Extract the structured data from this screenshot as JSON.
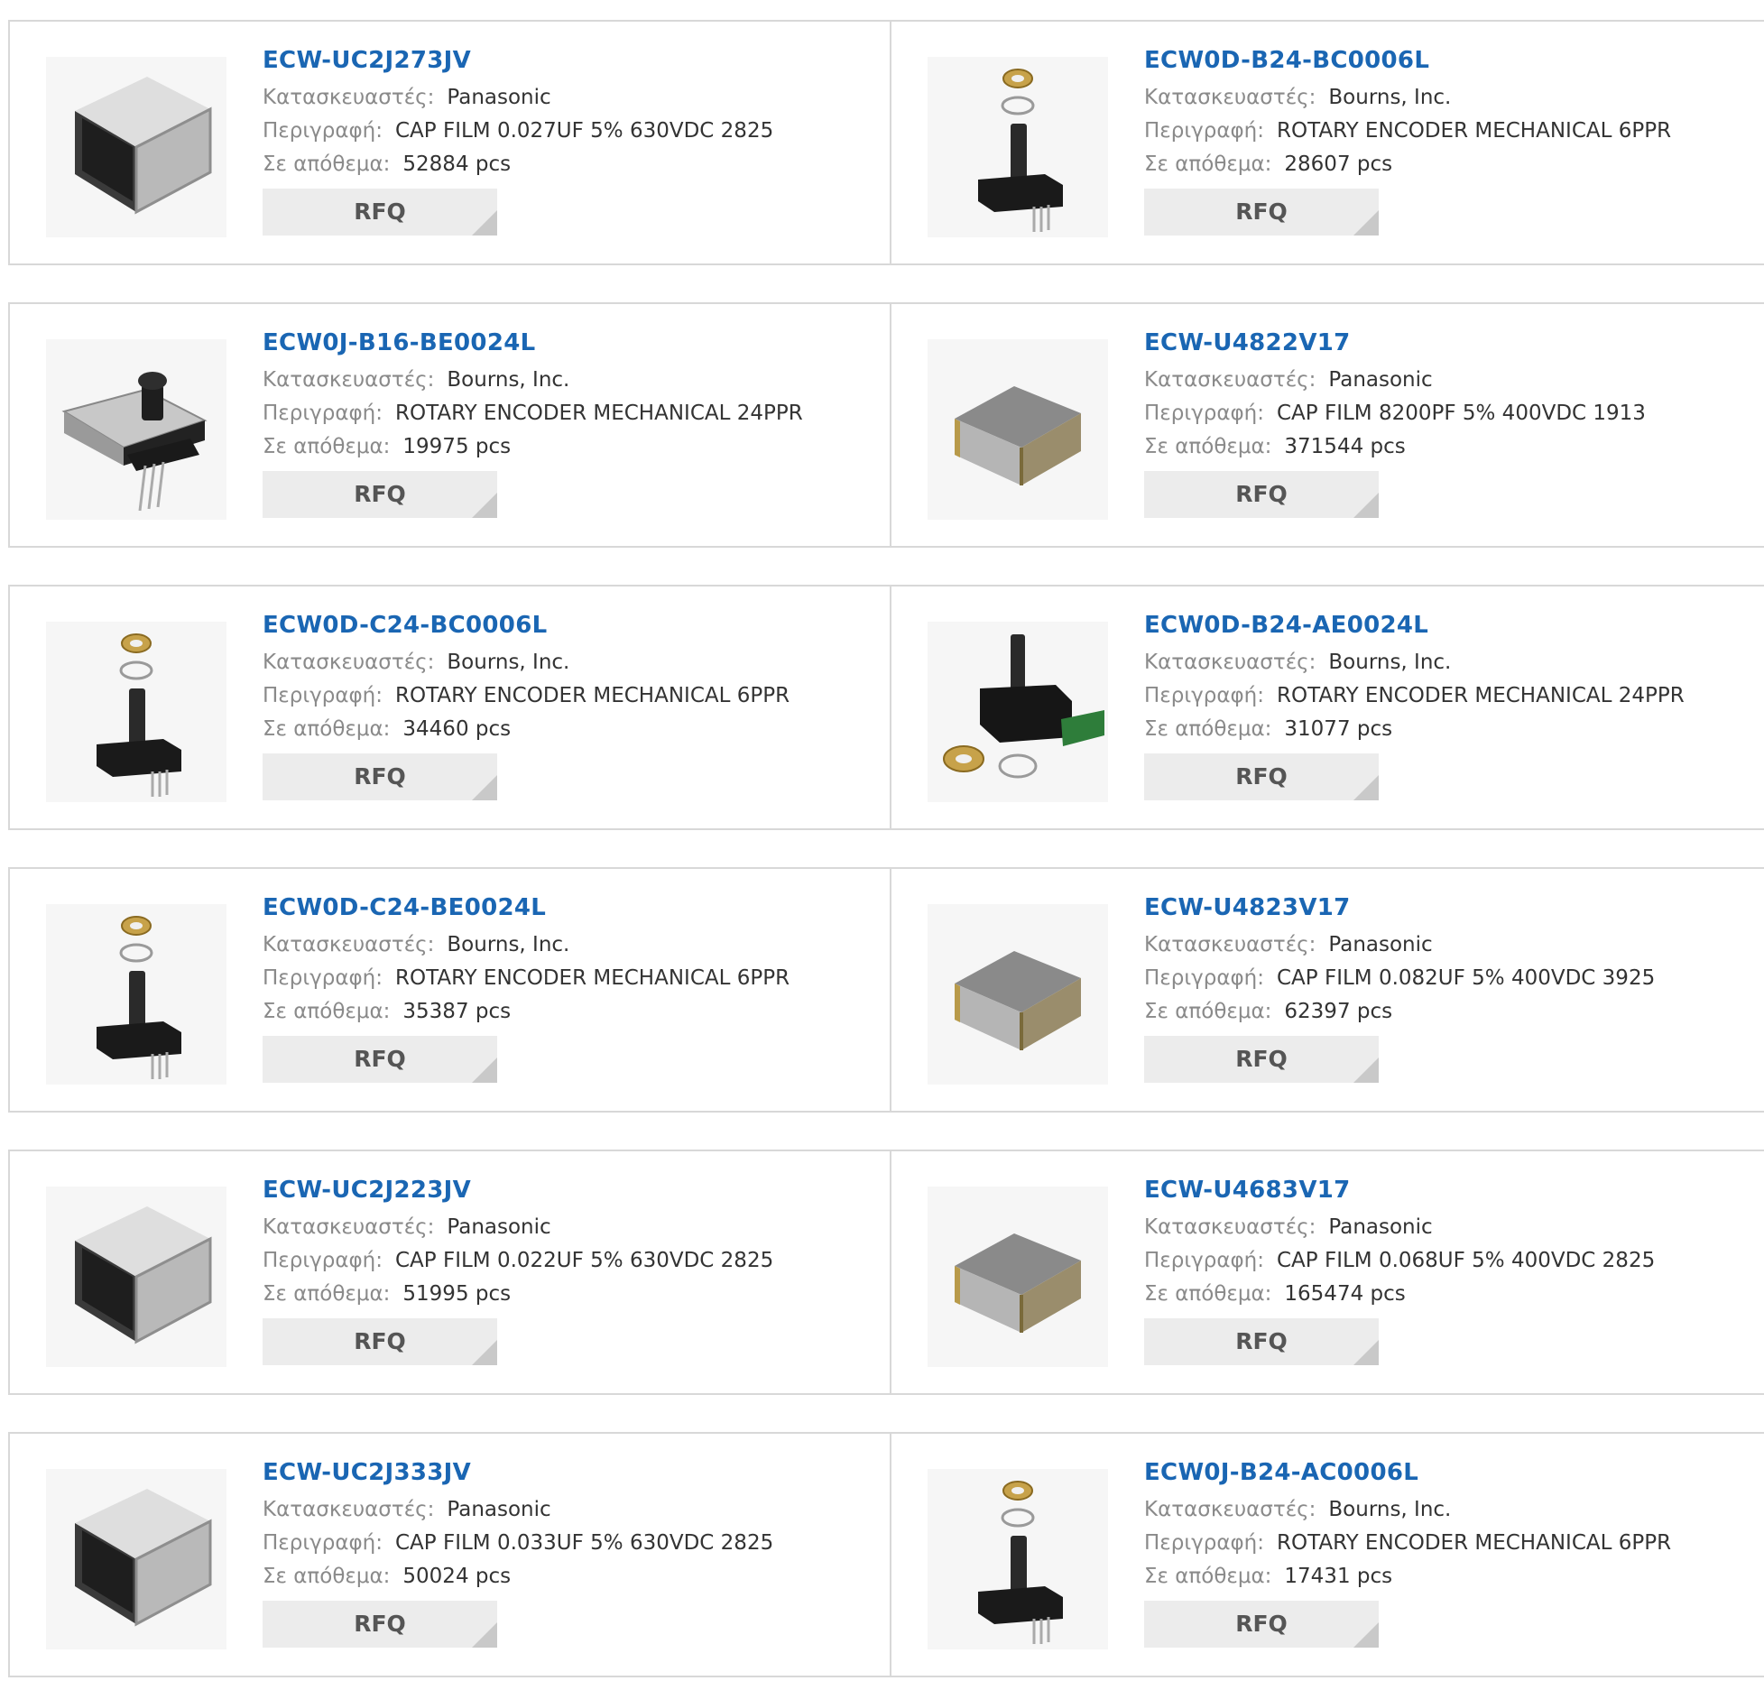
{
  "labels": {
    "manufacturer": "Κατασκευαστές:",
    "description": "Περιγραφή:",
    "stock": "Σε απόθεμα:",
    "rfq": "RFQ"
  },
  "products": [
    {
      "part": "ECW-UC2J273JV",
      "manufacturer": "Panasonic",
      "description": "CAP FILM 0.027UF 5% 630VDC 2825",
      "stock": "52884 pcs",
      "image": "film-capacitor-large"
    },
    {
      "part": "ECW0D-B24-BC0006L",
      "manufacturer": "Bourns, Inc.",
      "description": "ROTARY ENCODER MECHANICAL 6PPR",
      "stock": "28607 pcs",
      "image": "rotary-encoder"
    },
    {
      "part": "ECW0J-B16-BE0024L",
      "manufacturer": "Bourns, Inc.",
      "description": "ROTARY ENCODER MECHANICAL 24PPR",
      "stock": "19975 pcs",
      "image": "rotary-encoder-angled"
    },
    {
      "part": "ECW-U4822V17",
      "manufacturer": "Panasonic",
      "description": "CAP FILM 8200PF 5% 400VDC 1913",
      "stock": "371544 pcs",
      "image": "film-capacitor-small"
    },
    {
      "part": "ECW0D-C24-BC0006L",
      "manufacturer": "Bourns, Inc.",
      "description": "ROTARY ENCODER MECHANICAL 6PPR",
      "stock": "34460 pcs",
      "image": "rotary-encoder"
    },
    {
      "part": "ECW0D-B24-AE0024L",
      "manufacturer": "Bourns, Inc.",
      "description": "ROTARY ENCODER MECHANICAL 24PPR",
      "stock": "31077 pcs",
      "image": "rotary-encoder-pcb"
    },
    {
      "part": "ECW0D-C24-BE0024L",
      "manufacturer": "Bourns, Inc.",
      "description": "ROTARY ENCODER MECHANICAL 6PPR",
      "stock": "35387 pcs",
      "image": "rotary-encoder"
    },
    {
      "part": "ECW-U4823V17",
      "manufacturer": "Panasonic",
      "description": "CAP FILM 0.082UF 5% 400VDC 3925",
      "stock": "62397 pcs",
      "image": "film-capacitor-small"
    },
    {
      "part": "ECW-UC2J223JV",
      "manufacturer": "Panasonic",
      "description": "CAP FILM 0.022UF 5% 630VDC 2825",
      "stock": "51995 pcs",
      "image": "film-capacitor-large"
    },
    {
      "part": "ECW-U4683V17",
      "manufacturer": "Panasonic",
      "description": "CAP FILM 0.068UF 5% 400VDC 2825",
      "stock": "165474 pcs",
      "image": "film-capacitor-small"
    },
    {
      "part": "ECW-UC2J333JV",
      "manufacturer": "Panasonic",
      "description": "CAP FILM 0.033UF 5% 630VDC 2825",
      "stock": "50024 pcs",
      "image": "film-capacitor-large"
    },
    {
      "part": "ECW0J-B24-AC0006L",
      "manufacturer": "Bourns, Inc.",
      "description": "ROTARY ENCODER MECHANICAL 6PPR",
      "stock": "17431 pcs",
      "image": "rotary-encoder"
    }
  ]
}
